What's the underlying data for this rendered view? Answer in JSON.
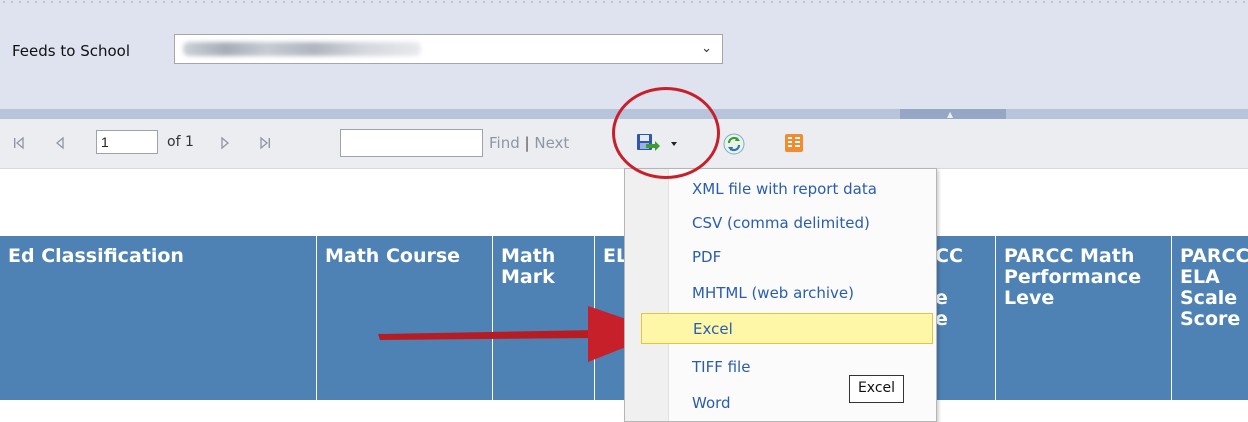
{
  "parameters": {
    "feeds_label": "Feeds to School",
    "feeds_value_blurred": true
  },
  "toolbar": {
    "page_value": "1",
    "of_text": "of 1",
    "find_label": "Find",
    "separator": "|",
    "next_label": "Next",
    "icons": [
      "first-page-icon",
      "previous-page-icon",
      "next-page-icon",
      "last-page-icon",
      "export-save-icon",
      "refresh-icon",
      "document-map-icon"
    ]
  },
  "export_menu": {
    "items": [
      "XML file with report data",
      "CSV (comma delimited)",
      "PDF",
      "MHTML (web archive)",
      "Excel",
      "TIFF file",
      "Word"
    ],
    "hovered": "Excel",
    "tooltip": "Excel"
  },
  "report": {
    "columns": [
      "Ed Classification",
      "Math Course",
      "Math Mark",
      "ELA",
      "PARCC",
      "PARCC Math Performance Leve",
      "PARCC ELA Scale Score"
    ],
    "visible_fragments": {
      "col4_lines": [
        "CC",
        "",
        "e",
        "e"
      ]
    }
  },
  "annotations": {
    "circle_color": "#c8202a",
    "arrow_color": "#c8202a"
  },
  "colors": {
    "header_blue": "#4e82b4",
    "param_bg": "#dfe3ef",
    "hover_yellow": "#fff7a8"
  }
}
